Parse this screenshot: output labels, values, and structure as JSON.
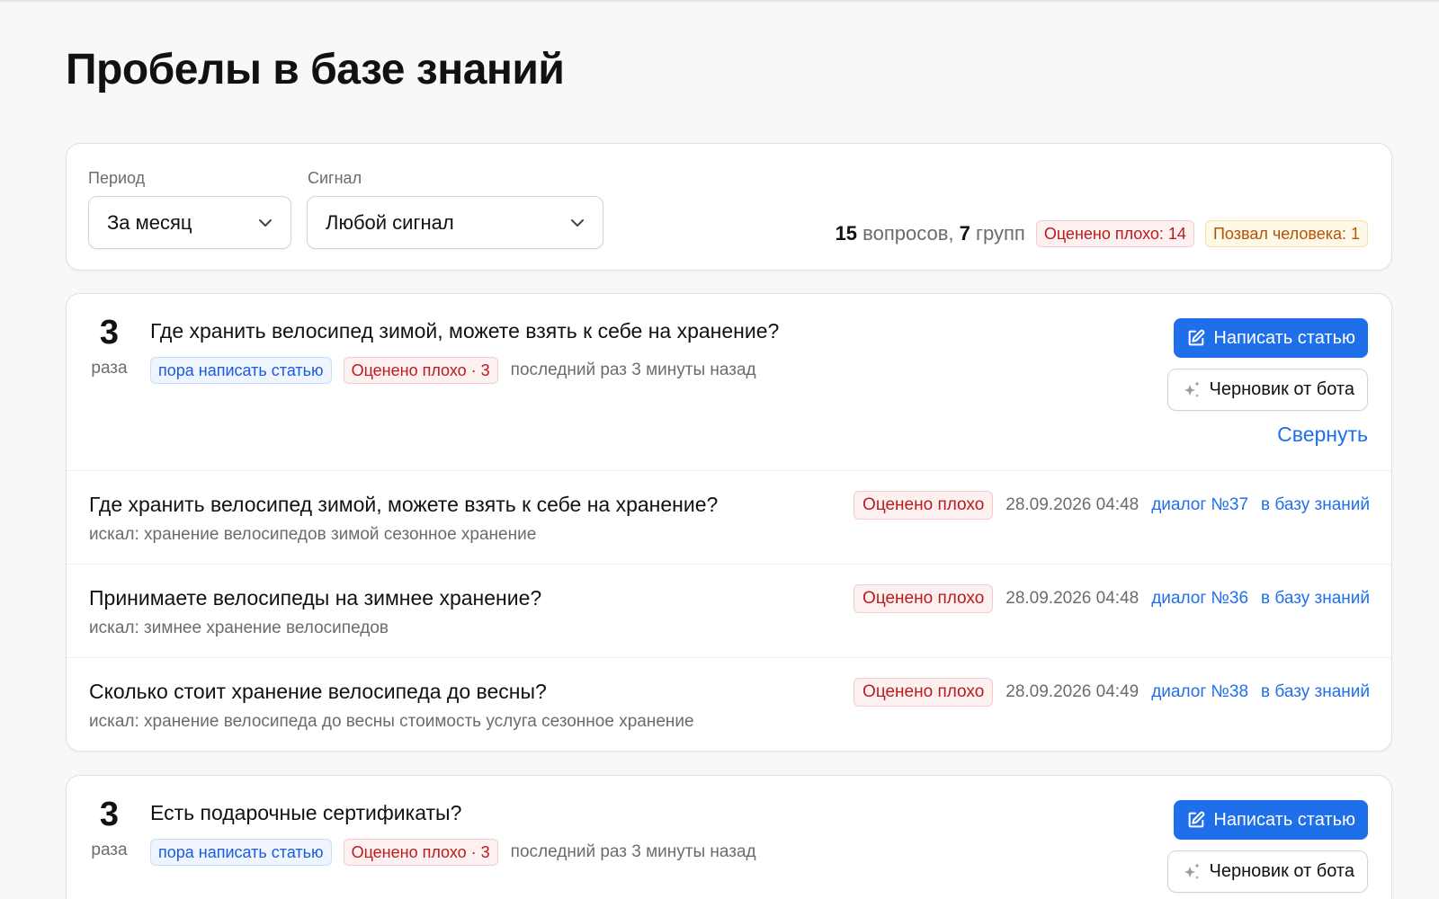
{
  "page": {
    "title": "Пробелы в базе знаний"
  },
  "filters": {
    "period_label": "Период",
    "period_value": "За месяц",
    "signal_label": "Сигнал",
    "signal_value": "Любой сигнал"
  },
  "stats": {
    "questions_count": "15",
    "questions_word": " вопросов, ",
    "groups_count": "7",
    "groups_word": " групп",
    "rated_bad": "Оценено плохо: 14",
    "called_human": "Позвал человека: 1"
  },
  "groups": [
    {
      "count": "3",
      "count_unit": "раза",
      "title": "Где хранить велосипед зимой, можете взять к себе на хранение?",
      "tag": "пора написать статью",
      "signal": "Оценено плохо · 3",
      "last_seen": "последний раз 3 минуты назад",
      "write_button": "Написать статью",
      "draft_button": "Черновик от бота",
      "collapse": "Свернуть",
      "questions": [
        {
          "text": "Где хранить велосипед зимой, можете взять к себе на хранение?",
          "searched": "искал: хранение велосипедов зимой сезонное хранение",
          "signal": "Оценено плохо",
          "date": "28.09.2026 04:48",
          "dialog": "диалог №37",
          "kb_link": "в базу знаний"
        },
        {
          "text": "Принимаете велосипеды на зимнее хранение?",
          "searched": "искал: зимнее хранение велосипедов",
          "signal": "Оценено плохо",
          "date": "28.09.2026 04:48",
          "dialog": "диалог №36",
          "kb_link": "в базу знаний"
        },
        {
          "text": "Сколько стоит хранение велосипеда до весны?",
          "searched": "искал: хранение велосипеда до весны стоимость услуга сезонное хранение",
          "signal": "Оценено плохо",
          "date": "28.09.2026 04:49",
          "dialog": "диалог №38",
          "kb_link": "в базу знаний"
        }
      ]
    },
    {
      "count": "3",
      "count_unit": "раза",
      "title": "Есть подарочные сертификаты?",
      "tag": "пора написать статью",
      "signal": "Оценено плохо · 3",
      "last_seen": "последний раз 3 минуты назад",
      "write_button": "Написать статью",
      "draft_button": "Черновик от бота"
    }
  ],
  "colors": {
    "accent": "#1f6feb",
    "danger": "#b91c1c",
    "warning": "#b45309",
    "muted": "#6b6b70"
  },
  "icons": {
    "write": "edit-icon",
    "draft": "sparkles-icon",
    "select": "chevron-down-icon"
  }
}
